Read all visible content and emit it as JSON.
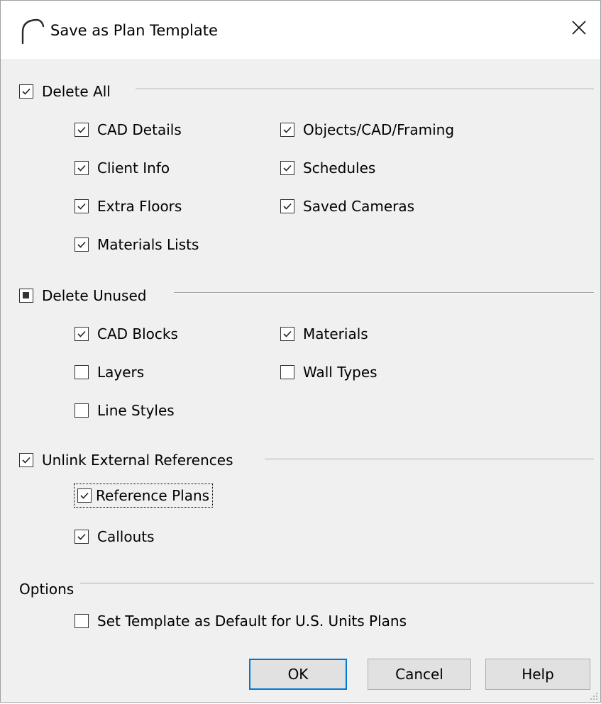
{
  "window": {
    "title": "Save as Plan Template",
    "close_label": "close",
    "icon": "arc-icon"
  },
  "delete_all": {
    "label": "Delete All",
    "state": "checked",
    "items": [
      {
        "label": "CAD Details",
        "checked": true
      },
      {
        "label": "Objects/CAD/Framing",
        "checked": true
      },
      {
        "label": "Client Info",
        "checked": true
      },
      {
        "label": "Schedules",
        "checked": true
      },
      {
        "label": "Extra Floors",
        "checked": true
      },
      {
        "label": "Saved Cameras",
        "checked": true
      },
      {
        "label": "Materials Lists",
        "checked": true
      }
    ]
  },
  "delete_unused": {
    "label": "Delete Unused",
    "state": "indeterminate",
    "items": [
      {
        "label": "CAD Blocks",
        "checked": true
      },
      {
        "label": "Materials",
        "checked": true
      },
      {
        "label": "Layers",
        "checked": false
      },
      {
        "label": "Wall Types",
        "checked": false
      },
      {
        "label": "Line Styles",
        "checked": false
      }
    ]
  },
  "unlink": {
    "label": "Unlink External References",
    "state": "checked",
    "items": [
      {
        "label": "Reference Plans",
        "checked": true,
        "focused": true
      },
      {
        "label": "Callouts",
        "checked": true
      }
    ]
  },
  "options": {
    "label": "Options",
    "items": [
      {
        "label": "Set Template as Default for U.S. Units Plans",
        "checked": false
      }
    ]
  },
  "buttons": {
    "ok": "OK",
    "cancel": "Cancel",
    "help": "Help"
  },
  "colors": {
    "dialog_bg": "#f0f0f0",
    "title_bg": "#ffffff",
    "default_button_border": "#0078d7",
    "button_bg": "#e1e1e1"
  }
}
